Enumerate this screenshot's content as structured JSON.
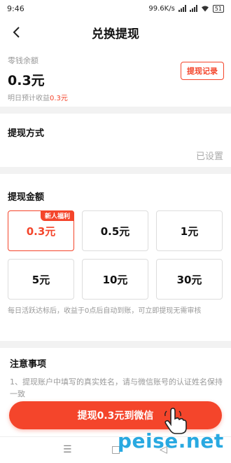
{
  "status_bar": {
    "time": "9:46",
    "network_speed": "99.6K/s",
    "battery": "51"
  },
  "header": {
    "title": "兑换提现"
  },
  "balance": {
    "label": "零钱余额",
    "amount": "0.3元",
    "estimate_prefix": "明日预计收益",
    "estimate_value": "0.3元",
    "record_button": "提现记录"
  },
  "method": {
    "title": "提现方式",
    "status": "已设置"
  },
  "amount_section": {
    "title": "提现金额",
    "options": [
      {
        "label": "0.3元",
        "tag": "新人福利"
      },
      {
        "label": "0.5元"
      },
      {
        "label": "1元"
      },
      {
        "label": "5元"
      },
      {
        "label": "10元"
      },
      {
        "label": "30元"
      }
    ],
    "note": "每日活跃达标后，收益于0点后自动到账，可立即提现无需审核"
  },
  "notes": {
    "title": "注意事项",
    "body": "1、提现账户中填写的真实姓名，请与微信账号的认证姓名保持一致"
  },
  "withdraw_button": "提现0.3元到微信",
  "system_nav": {
    "menu": "☰",
    "home": "□",
    "back": "◁"
  },
  "watermark": "peise.net",
  "colors": {
    "accent": "#f4452b",
    "watermark": "#29a9e1"
  },
  "icons": [
    "back-arrow-icon",
    "signal-icon",
    "wifi-icon",
    "battery-icon",
    "hand-pointer-icon"
  ]
}
